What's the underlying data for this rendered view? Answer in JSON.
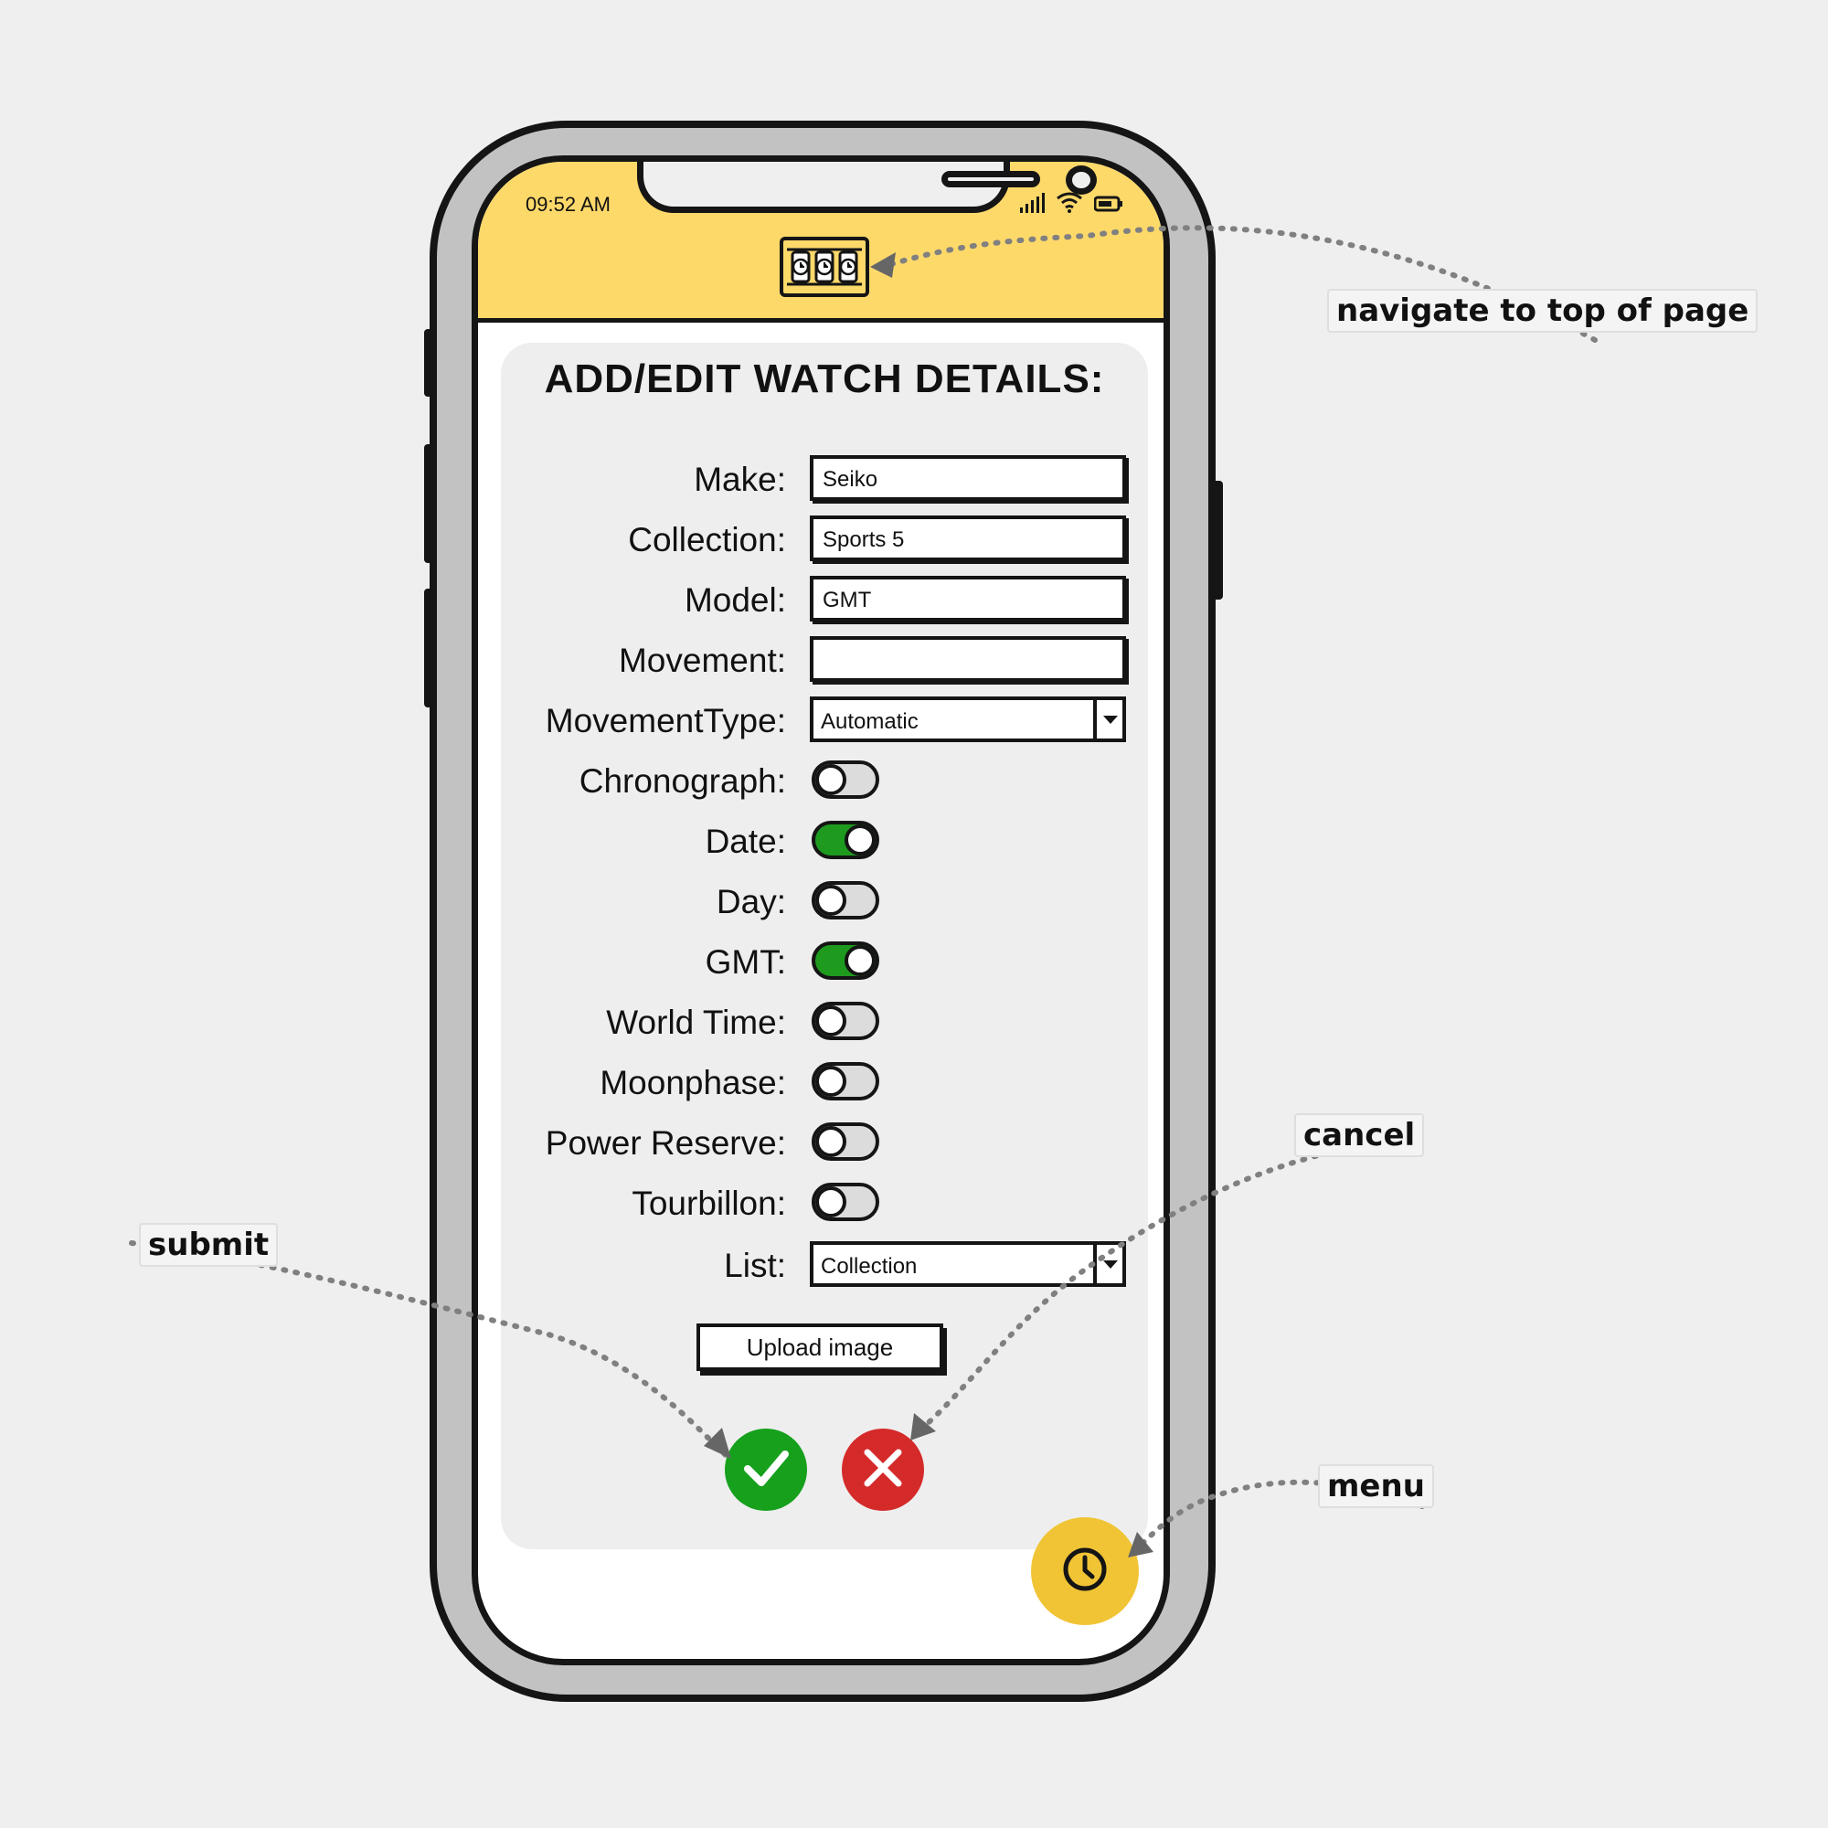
{
  "status_bar": {
    "time": "09:52 AM"
  },
  "header": {
    "logo_icon": "watch-box-icon"
  },
  "form": {
    "title": "ADD/EDIT WATCH DETAILS:",
    "fields": {
      "make": {
        "label": "Make:",
        "value": "Seiko"
      },
      "collection": {
        "label": "Collection:",
        "value": "Sports 5"
      },
      "model": {
        "label": "Model:",
        "value": "GMT"
      },
      "movement": {
        "label": "Movement:",
        "value": ""
      },
      "movement_type": {
        "label": "MovementType:",
        "value": "Automatic"
      },
      "list": {
        "label": "List:",
        "value": "Collection"
      }
    },
    "toggles": [
      {
        "label": "Chronograph:",
        "on": false
      },
      {
        "label": "Date:",
        "on": true
      },
      {
        "label": "Day:",
        "on": false
      },
      {
        "label": "GMT:",
        "on": true
      },
      {
        "label": "World Time:",
        "on": false
      },
      {
        "label": "Moonphase:",
        "on": false
      },
      {
        "label": "Power Reserve:",
        "on": false
      },
      {
        "label": "Tourbillon:",
        "on": false
      }
    ],
    "upload_label": "Upload image",
    "submit_icon": "check-icon",
    "cancel_icon": "close-icon"
  },
  "fab": {
    "icon": "clock-icon"
  },
  "annotations": {
    "navigate_top": "navigate to top of page",
    "cancel": "cancel",
    "submit": "submit",
    "menu": "menu"
  },
  "colors": {
    "header": "#fdd96a",
    "toggle_on": "#1e9a1e",
    "submit": "#16a01c",
    "cancel": "#d52a2a",
    "fab": "#f1c435"
  }
}
